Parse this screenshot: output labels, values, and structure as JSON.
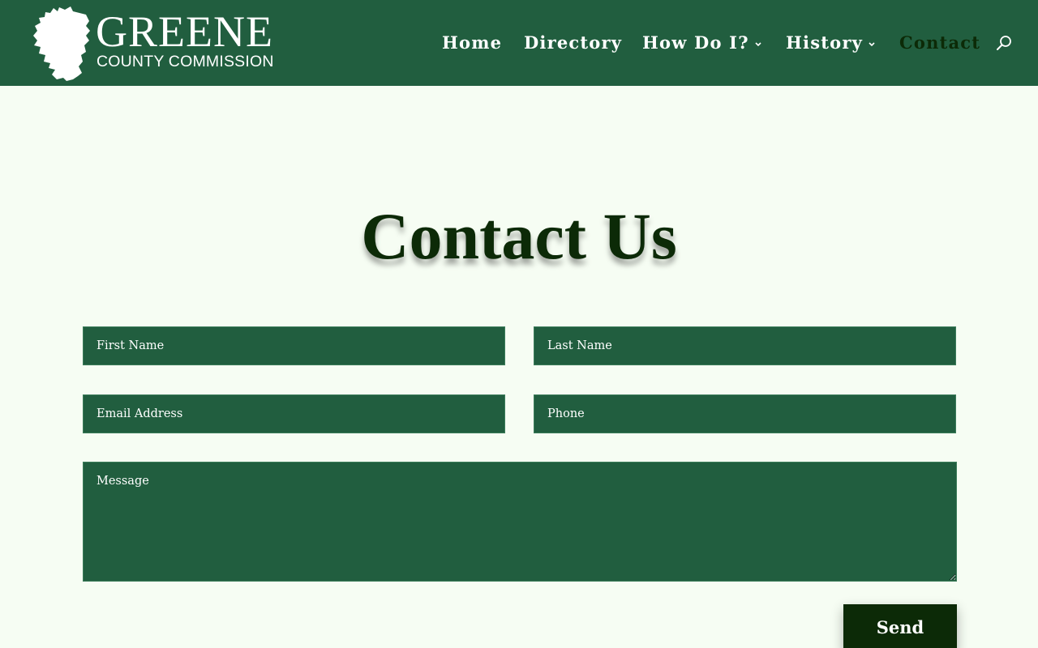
{
  "header": {
    "logo": {
      "title": "GREENE",
      "subtitle": "COUNTY COMMISSION",
      "icon": "county-map-icon"
    },
    "nav": [
      {
        "label": "Home",
        "active": false,
        "has_dropdown": false
      },
      {
        "label": "Directory",
        "active": false,
        "has_dropdown": false
      },
      {
        "label": "How Do I?",
        "active": false,
        "has_dropdown": true
      },
      {
        "label": "History",
        "active": false,
        "has_dropdown": true
      },
      {
        "label": "Contact",
        "active": true,
        "has_dropdown": false
      }
    ],
    "search_icon": "search-icon"
  },
  "page": {
    "title": "Contact Us"
  },
  "form": {
    "first_name": {
      "placeholder": "First Name",
      "value": ""
    },
    "last_name": {
      "placeholder": "Last Name",
      "value": ""
    },
    "email": {
      "placeholder": "Email Address",
      "value": ""
    },
    "phone": {
      "placeholder": "Phone",
      "value": ""
    },
    "message": {
      "placeholder": "Message",
      "value": ""
    },
    "submit_label": "Send"
  },
  "colors": {
    "header_bg": "#215e3f",
    "page_bg": "#f6fdf3",
    "field_bg": "#215e3f",
    "dark_green": "#0c2a07",
    "white": "#ffffff"
  }
}
